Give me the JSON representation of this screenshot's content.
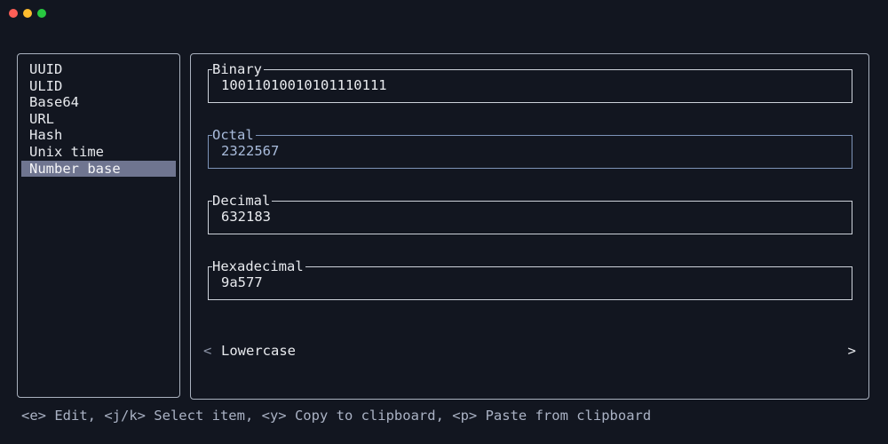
{
  "window": {
    "controls": [
      "close",
      "minimize",
      "maximize"
    ]
  },
  "sidebar": {
    "items": [
      {
        "label": "UUID"
      },
      {
        "label": "ULID"
      },
      {
        "label": "Base64"
      },
      {
        "label": "URL"
      },
      {
        "label": "Hash"
      },
      {
        "label": "Unix time"
      },
      {
        "label": "Number base",
        "selected": true
      }
    ]
  },
  "main": {
    "fields": [
      {
        "label": "Binary",
        "value": "10011010010101110111"
      },
      {
        "label": "Octal",
        "value": "2322567",
        "focused": true
      },
      {
        "label": "Decimal",
        "value": "632183"
      },
      {
        "label": "Hexadecimal",
        "value": "9a577"
      }
    ],
    "case_toggle": {
      "prev": "<",
      "value": "Lowercase",
      "next": ">"
    }
  },
  "footer": {
    "help": "<e> Edit, <j/k> Select item, <y> Copy to clipboard, <p> Paste from clipboard"
  },
  "colors": {
    "background": "#121620",
    "selection": "#6f7590",
    "focus": "#a9bcdc",
    "close": "#ff5f57",
    "minimize": "#febc2e",
    "maximize": "#28c840"
  }
}
